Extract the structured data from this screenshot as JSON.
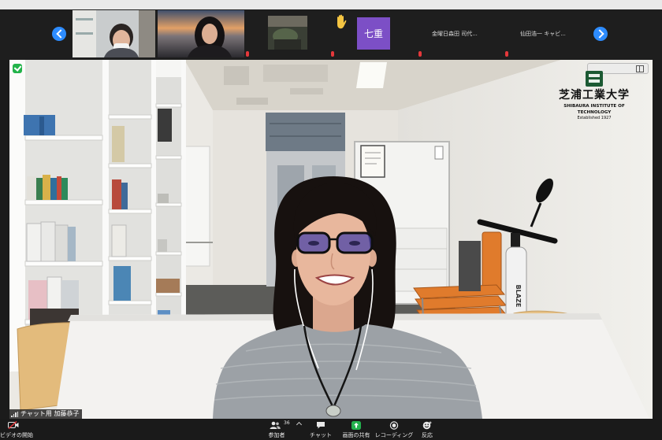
{
  "gallery": {
    "tiles": [
      {
        "kind": "video"
      },
      {
        "kind": "video"
      },
      {
        "kind": "video"
      },
      {
        "kind": "avatar",
        "avatar_text": "七重",
        "reaction_icon": "raised-hand-icon"
      },
      {
        "kind": "name-only",
        "name": "金曜日森田 司代..."
      },
      {
        "kind": "name-only",
        "name": "仙田浩一 キャビ..."
      }
    ],
    "nav_icons": [
      "chevron-left-icon",
      "chevron-right-icon"
    ]
  },
  "main": {
    "speaker_name": "チャット用 加藤恭子",
    "logo": {
      "jp": "芝浦工業大学",
      "en": "SHIBAURA INSTITUTE OF TECHNOLOGY",
      "established": "Established 1927"
    },
    "scooter_brand": "BLAZE"
  },
  "toolbar": {
    "video_label": "ビデオの開始",
    "participants_label": "参加者",
    "participants_count": "36",
    "chat_label": "チャット",
    "share_label": "画面の共有",
    "record_label": "レコーディング",
    "reactions_label": "反応"
  },
  "colors": {
    "accent_blue": "#2d8cff",
    "share_green": "#23b14d",
    "muted_red": "#e5383b",
    "avatar_purple": "#7c4fc6",
    "toolbar_bg": "#1a1a1a"
  }
}
